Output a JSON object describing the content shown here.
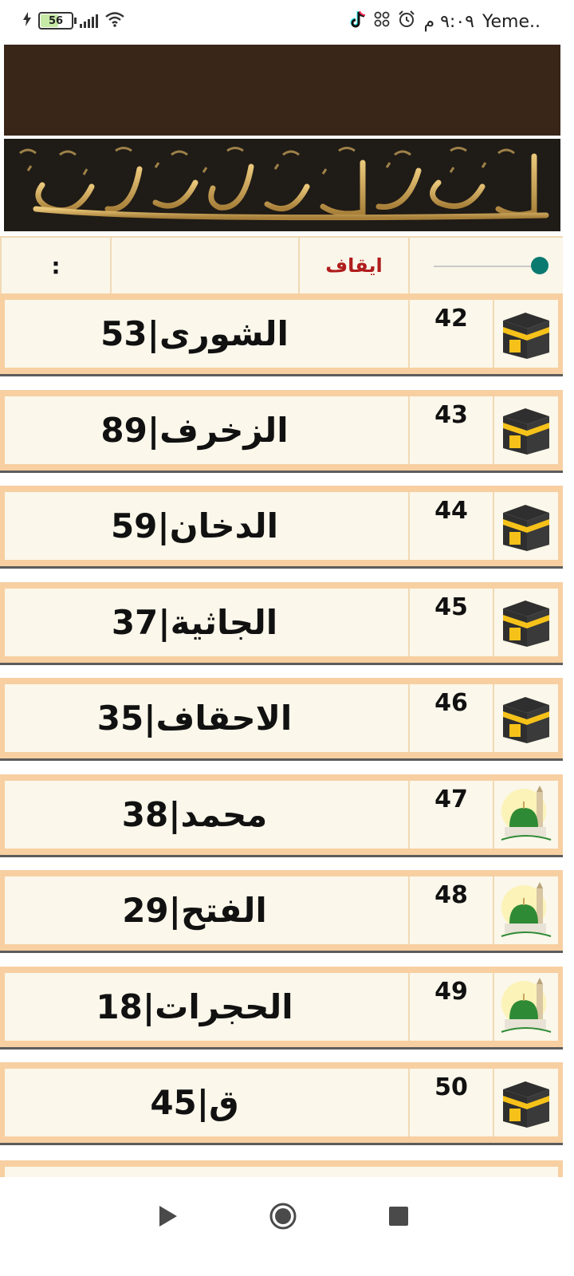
{
  "status_bar": {
    "battery_level": "56",
    "clock": "٩:٠٩ م",
    "carrier": "Yeme.."
  },
  "control_bar": {
    "stop_label": "ايقاف",
    "time_text": ":",
    "slider_position": 1.0
  },
  "icon_colors": {
    "kaaba_black": "#2f2f2f",
    "kaaba_gold": "#f6c21a",
    "dome_green": "#2f8a35",
    "accent_teal": "#0a7a70",
    "stop_red": "#b01d1d"
  },
  "surahs": [
    {
      "number": "42",
      "title": "الشورى|53",
      "icon": "kaaba-icon"
    },
    {
      "number": "43",
      "title": "الزخرف|89",
      "icon": "kaaba-icon"
    },
    {
      "number": "44",
      "title": "الدخان|59",
      "icon": "kaaba-icon"
    },
    {
      "number": "45",
      "title": "الجاثية|37",
      "icon": "kaaba-icon"
    },
    {
      "number": "46",
      "title": "الاحقاف|35",
      "icon": "kaaba-icon"
    },
    {
      "number": "47",
      "title": "محمد|38",
      "icon": "mosque-dome-icon"
    },
    {
      "number": "48",
      "title": "الفتح|29",
      "icon": "mosque-dome-icon"
    },
    {
      "number": "49",
      "title": "الحجرات|18",
      "icon": "mosque-dome-icon"
    },
    {
      "number": "50",
      "title": "ق|45",
      "icon": "kaaba-icon"
    }
  ]
}
